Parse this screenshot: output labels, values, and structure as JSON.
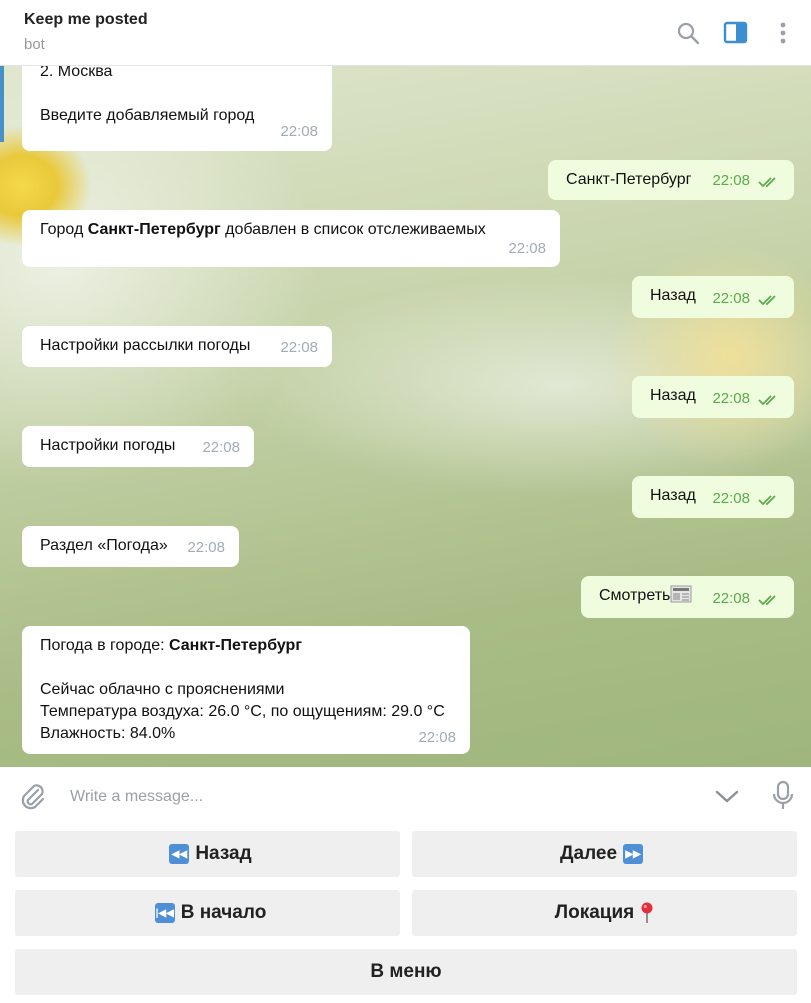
{
  "header": {
    "title": "Keep me posted",
    "status": "bot"
  },
  "messages": [
    {
      "side": "in",
      "text": "2. Москва",
      "line2": "Введите добавляемый город",
      "time": "22:08"
    },
    {
      "side": "out",
      "text": "Санкт-Петербург",
      "time": "22:08"
    },
    {
      "side": "in",
      "prefix": "Город ",
      "bold": "Санкт-Петербург",
      "suffix": " добавлен в список отслеживаемых",
      "time": "22:08"
    },
    {
      "side": "out",
      "text": "Назад",
      "time": "22:08"
    },
    {
      "side": "in",
      "text": "Настройки рассылки погоды",
      "time": "22:08"
    },
    {
      "side": "out",
      "text": "Назад",
      "time": "22:08"
    },
    {
      "side": "in",
      "text": "Настройки погоды",
      "time": "22:08"
    },
    {
      "side": "out",
      "text": "Назад",
      "time": "22:08"
    },
    {
      "side": "in",
      "text": "Раздел «Погода»",
      "time": "22:08"
    },
    {
      "side": "out",
      "text": "Смотреть",
      "time": "22:08"
    },
    {
      "side": "in",
      "prefix": "Погода в городе: ",
      "bold": "Санкт-Петербург",
      "line2": "Сейчас облачно с прояснениями",
      "line3": "Температура воздуха: 26.0 °C, по ощущениям: 29.0 °C",
      "line4": "Влажность: 84.0%",
      "time": "22:08"
    }
  ],
  "input": {
    "placeholder": "Write a message..."
  },
  "keyboard": {
    "back": "Назад",
    "next": "Далее",
    "start": "В начало",
    "location": "Локация",
    "menu": "В меню"
  },
  "icons": {
    "search": "search-icon",
    "sidebar": "sidebar-toggle-icon",
    "more": "more-vertical-icon",
    "attach": "paperclip-icon",
    "keyboard_toggle": "chevron-down-icon",
    "mic": "microphone-icon",
    "rewind": "rewind-emoji",
    "fast_forward": "fast-forward-emoji",
    "previous": "previous-track-emoji",
    "pin": "round-pushpin-emoji",
    "newspaper": "newspaper-emoji"
  },
  "colors": {
    "accent": "#4a90c8",
    "outgoing_bubble": "#effdde",
    "incoming_bubble": "#ffffff",
    "check": "#5cab4a"
  }
}
